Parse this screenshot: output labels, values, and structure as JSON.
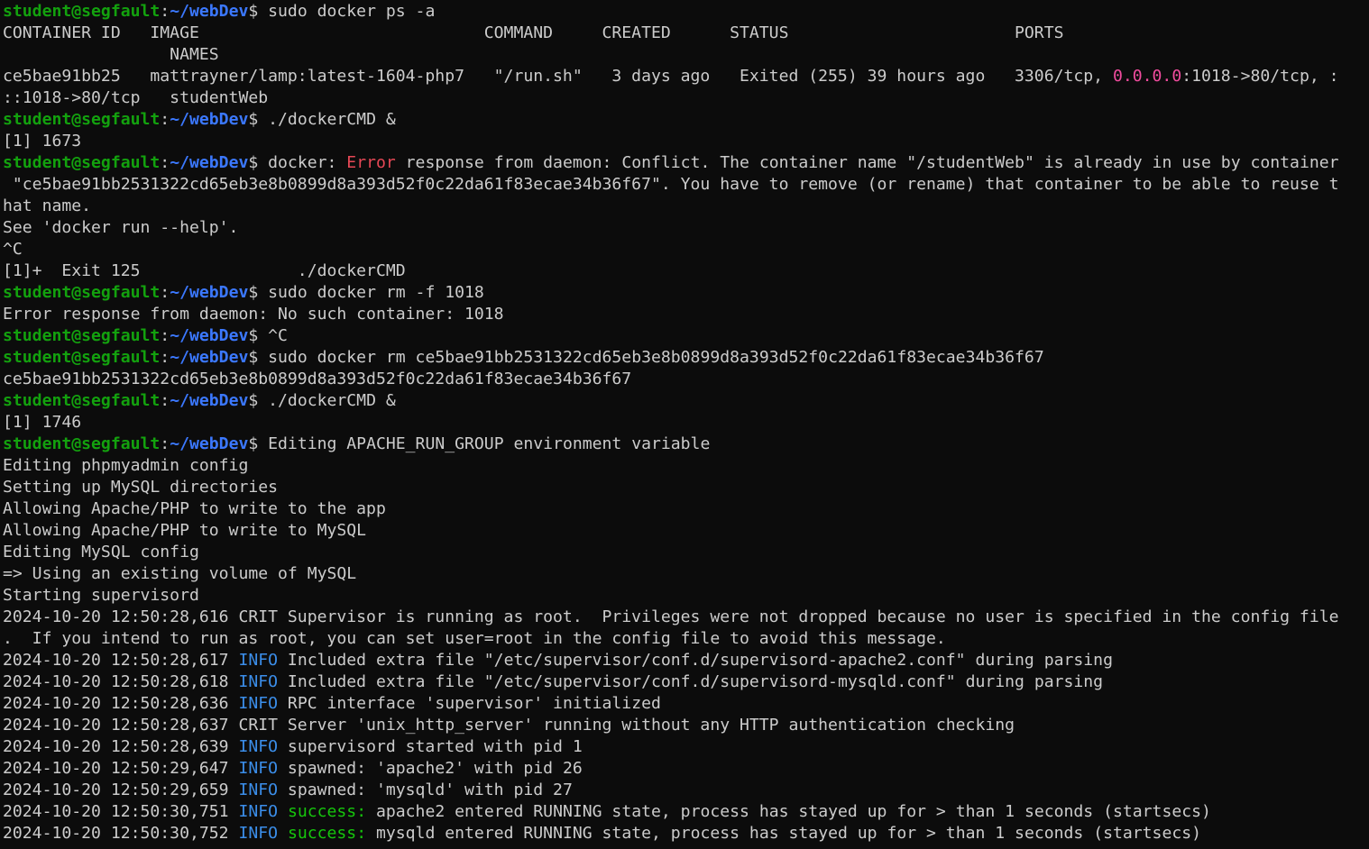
{
  "terminal": {
    "lines": [
      [
        {
          "t": "student@segfault",
          "c": "prompt-user"
        },
        {
          "t": ":"
        },
        {
          "t": "~/webDev",
          "c": "prompt-path"
        },
        {
          "t": "$ sudo docker ps -a"
        }
      ],
      [
        {
          "t": "CONTAINER ID   IMAGE                             COMMAND     CREATED      STATUS                       PORTS"
        }
      ],
      [
        {
          "t": "                 NAMES"
        }
      ],
      [
        {
          "t": "ce5bae91bb25   mattrayner/lamp:latest-1604-php7   \"/run.sh\"   3 days ago   Exited (255) 39 hours ago   3306/tcp, "
        },
        {
          "t": "0.0.0.0",
          "c": "magenta"
        },
        {
          "t": ":1018->80/tcp, :"
        }
      ],
      [
        {
          "t": "::1018->80/tcp   studentWeb"
        }
      ],
      [
        {
          "t": "student@segfault",
          "c": "prompt-user"
        },
        {
          "t": ":"
        },
        {
          "t": "~/webDev",
          "c": "prompt-path"
        },
        {
          "t": "$ ./dockerCMD &"
        }
      ],
      [
        {
          "t": "[1] 1673"
        }
      ],
      [
        {
          "t": "student@segfault",
          "c": "prompt-user"
        },
        {
          "t": ":"
        },
        {
          "t": "~/webDev",
          "c": "prompt-path"
        },
        {
          "t": "$ docker: "
        },
        {
          "t": "Error",
          "c": "red"
        },
        {
          "t": " response from daemon: Conflict. The container name \"/studentWeb\" is already in use by container"
        }
      ],
      [
        {
          "t": " \"ce5bae91bb2531322cd65eb3e8b0899d8a393d52f0c22da61f83ecae34b36f67\". You have to remove (or rename) that container to be able to reuse t"
        }
      ],
      [
        {
          "t": "hat name."
        }
      ],
      [
        {
          "t": "See 'docker run --help'."
        }
      ],
      [
        {
          "t": "^C"
        }
      ],
      [
        {
          "t": "[1]+  Exit 125                ./dockerCMD"
        }
      ],
      [
        {
          "t": "student@segfault",
          "c": "prompt-user"
        },
        {
          "t": ":"
        },
        {
          "t": "~/webDev",
          "c": "prompt-path"
        },
        {
          "t": "$ sudo docker rm -f 1018"
        }
      ],
      [
        {
          "t": "Error response from daemon: No such container: 1018"
        }
      ],
      [
        {
          "t": "student@segfault",
          "c": "prompt-user"
        },
        {
          "t": ":"
        },
        {
          "t": "~/webDev",
          "c": "prompt-path"
        },
        {
          "t": "$ ^C"
        }
      ],
      [
        {
          "t": "student@segfault",
          "c": "prompt-user"
        },
        {
          "t": ":"
        },
        {
          "t": "~/webDev",
          "c": "prompt-path"
        },
        {
          "t": "$ sudo docker rm ce5bae91bb2531322cd65eb3e8b0899d8a393d52f0c22da61f83ecae34b36f67"
        }
      ],
      [
        {
          "t": "ce5bae91bb2531322cd65eb3e8b0899d8a393d52f0c22da61f83ecae34b36f67"
        }
      ],
      [
        {
          "t": "student@segfault",
          "c": "prompt-user"
        },
        {
          "t": ":"
        },
        {
          "t": "~/webDev",
          "c": "prompt-path"
        },
        {
          "t": "$ ./dockerCMD &"
        }
      ],
      [
        {
          "t": "[1] 1746"
        }
      ],
      [
        {
          "t": "student@segfault",
          "c": "prompt-user"
        },
        {
          "t": ":"
        },
        {
          "t": "~/webDev",
          "c": "prompt-path"
        },
        {
          "t": "$ Editing APACHE_RUN_GROUP environment variable"
        }
      ],
      [
        {
          "t": "Editing phpmyadmin config"
        }
      ],
      [
        {
          "t": "Setting up MySQL directories"
        }
      ],
      [
        {
          "t": "Allowing Apache/PHP to write to the app"
        }
      ],
      [
        {
          "t": "Allowing Apache/PHP to write to MySQL"
        }
      ],
      [
        {
          "t": "Editing MySQL config"
        }
      ],
      [
        {
          "t": "=> Using an existing volume of MySQL"
        }
      ],
      [
        {
          "t": "Starting supervisord"
        }
      ],
      [
        {
          "t": "2024-10-20 12:50:28,616 CRIT Supervisor is running as root.  Privileges were not dropped because no user is specified in the config file"
        }
      ],
      [
        {
          "t": ".  If you intend to run as root, you can set user=root in the config file to avoid this message."
        }
      ],
      [
        {
          "t": "2024-10-20 12:50:28,617 "
        },
        {
          "t": "INFO",
          "c": "blue"
        },
        {
          "t": " Included extra file \"/etc/supervisor/conf.d/supervisord-apache2.conf\" during parsing"
        }
      ],
      [
        {
          "t": "2024-10-20 12:50:28,618 "
        },
        {
          "t": "INFO",
          "c": "blue"
        },
        {
          "t": " Included extra file \"/etc/supervisor/conf.d/supervisord-mysqld.conf\" during parsing"
        }
      ],
      [
        {
          "t": "2024-10-20 12:50:28,636 "
        },
        {
          "t": "INFO",
          "c": "blue"
        },
        {
          "t": " RPC interface 'supervisor' initialized"
        }
      ],
      [
        {
          "t": "2024-10-20 12:50:28,637 CRIT Server 'unix_http_server' running without any HTTP authentication checking"
        }
      ],
      [
        {
          "t": "2024-10-20 12:50:28,639 "
        },
        {
          "t": "INFO",
          "c": "blue"
        },
        {
          "t": " supervisord started with pid 1"
        }
      ],
      [
        {
          "t": "2024-10-20 12:50:29,647 "
        },
        {
          "t": "INFO",
          "c": "blue"
        },
        {
          "t": " spawned: 'apache2' with pid 26"
        }
      ],
      [
        {
          "t": "2024-10-20 12:50:29,659 "
        },
        {
          "t": "INFO",
          "c": "blue"
        },
        {
          "t": " spawned: 'mysqld' with pid 27"
        }
      ],
      [
        {
          "t": "2024-10-20 12:50:30,751 "
        },
        {
          "t": "INFO",
          "c": "blue"
        },
        {
          "t": " "
        },
        {
          "t": "success:",
          "c": "green"
        },
        {
          "t": " apache2 entered RUNNING state, process has stayed up for > than 1 seconds (startsecs)"
        }
      ],
      [
        {
          "t": "2024-10-20 12:50:30,752 "
        },
        {
          "t": "INFO",
          "c": "blue"
        },
        {
          "t": " "
        },
        {
          "t": "success:",
          "c": "green"
        },
        {
          "t": " mysqld entered RUNNING state, process has stayed up for > than 1 seconds (startsecs)"
        }
      ]
    ]
  },
  "colors": {
    "background": "#0c0c0c",
    "foreground": "#cccccc",
    "prompt_user": "#13a10e",
    "prompt_path": "#3b78ff",
    "error": "#e74856",
    "ip": "#f14c9e",
    "info": "#3b8eea",
    "success": "#16c60c"
  }
}
